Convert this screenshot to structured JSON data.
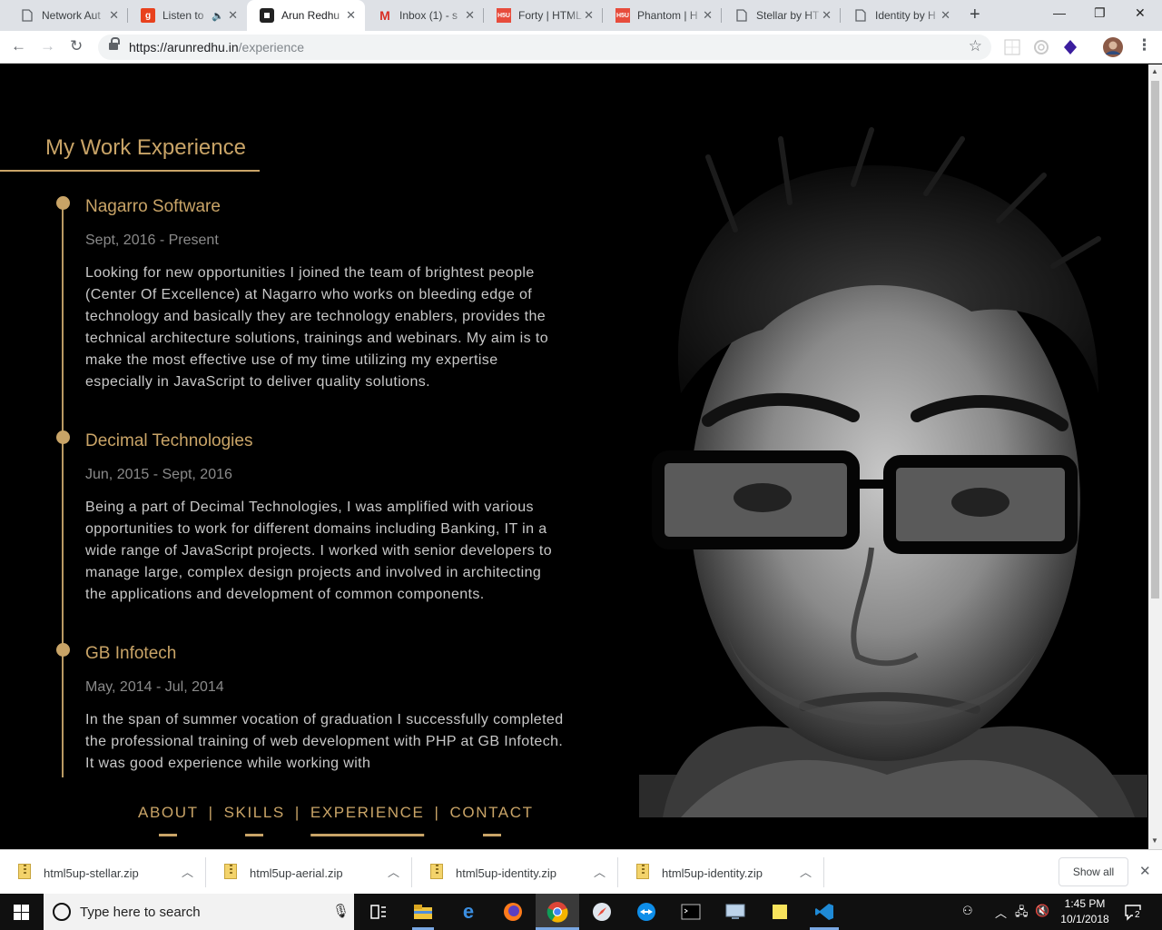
{
  "browser": {
    "tabs": [
      {
        "title": "Network Aut",
        "favicon": "doc"
      },
      {
        "title": "Listen to",
        "favicon": "g"
      },
      {
        "title": "Arun Redhu",
        "favicon": "site"
      },
      {
        "title": "Inbox (1) - s",
        "favicon": "M"
      },
      {
        "title": "Forty | HTML",
        "favicon": "H5U"
      },
      {
        "title": "Phantom | H",
        "favicon": "H5U"
      },
      {
        "title": "Stellar by HT",
        "favicon": "doc"
      },
      {
        "title": "Identity by H",
        "favicon": "doc"
      }
    ],
    "url_host": "https://arunredhu.in",
    "url_path": "/experience"
  },
  "page": {
    "title": "My Work Experience",
    "jobs": [
      {
        "company": "Nagarro Software",
        "period": "Sept, 2016 - Present",
        "description": "Looking for new opportunities I joined the team of brightest people (Center Of Excellence) at Nagarro who works on bleeding edge of technology and basically they are technology enablers, provides the technical architecture solutions, trainings and webinars. My aim is to make the most effective use of my time utilizing my expertise especially in JavaScript to deliver quality solutions."
      },
      {
        "company": "Decimal Technologies",
        "period": "Jun, 2015 - Sept, 2016",
        "description": "Being a part of Decimal Technologies, I was amplified with various opportunities to work for different domains including Banking, IT in a wide range of JavaScript projects. I worked with senior developers to manage large, complex design projects and involved in architecting the applications and development of common components."
      },
      {
        "company": "GB Infotech",
        "period": "May, 2014 - Jul, 2014",
        "description": "In the span of summer vocation of graduation I successfully completed the professional training of web development with PHP at GB Infotech. It was good experience while working with"
      }
    ],
    "nav": {
      "about": "ABOUT",
      "skills": "SKILLS",
      "experience": "EXPERIENCE",
      "contact": "CONTACT",
      "separator": "|"
    },
    "accent_color": "#c9a467"
  },
  "downloads": {
    "items": [
      "html5up-stellar.zip",
      "html5up-aerial.zip",
      "html5up-identity.zip",
      "html5up-identity.zip"
    ],
    "show_all": "Show all"
  },
  "taskbar": {
    "search_placeholder": "Type here to search",
    "time": "1:45 PM",
    "date": "10/1/2018",
    "notifications": "2"
  }
}
